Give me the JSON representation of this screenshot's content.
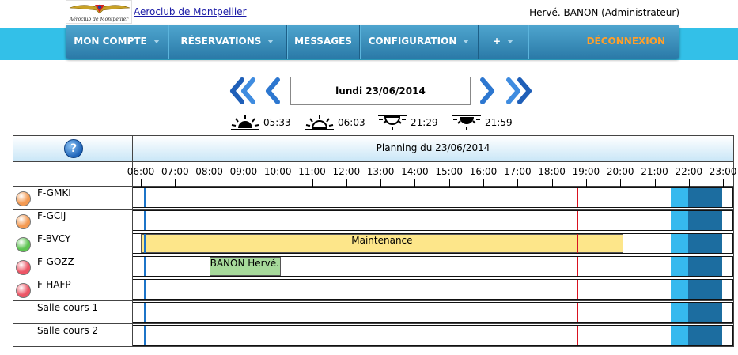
{
  "header": {
    "logo_text": "Aéroclub de Montpellier",
    "site_link": "Aeroclub de Montpellier",
    "user": "Hervé. BANON (Administrateur)"
  },
  "nav": {
    "items": [
      {
        "label": "MON COMPTE",
        "has_caret": true
      },
      {
        "label": "RÉSERVATIONS",
        "has_caret": true
      },
      {
        "label": "MESSAGES",
        "has_caret": false
      },
      {
        "label": "CONFIGURATION",
        "has_caret": true
      },
      {
        "label": "+",
        "has_caret": true
      }
    ],
    "logout": "DÉCONNEXION",
    "logout_color": "#ff9f2a"
  },
  "date_nav": {
    "current_date": "lundi 23/06/2014",
    "icons": [
      "double-left-arrow-icon",
      "left-arrow-icon",
      "right-arrow-icon",
      "double-right-arrow-icon"
    ]
  },
  "sun_times": [
    {
      "icon": "sunrise-dawn-icon",
      "time": "05:33"
    },
    {
      "icon": "sunrise-icon",
      "time": "06:03"
    },
    {
      "icon": "sunset-icon",
      "time": "21:29"
    },
    {
      "icon": "sunset-dusk-icon",
      "time": "21:59"
    }
  ],
  "planning": {
    "title": "Planning du 23/06/2014",
    "hours": [
      "06:00",
      "07:00",
      "08:00",
      "09:00",
      "10:00",
      "11:00",
      "12:00",
      "13:00",
      "14:00",
      "15:00",
      "16:00",
      "17:00",
      "18:00",
      "19:00",
      "20:00",
      "21:00",
      "22:00",
      "23:00"
    ],
    "resources": [
      {
        "name": "F-GMKI",
        "status": "orange",
        "reservations": []
      },
      {
        "name": "F-GCIJ",
        "status": "orange",
        "reservations": []
      },
      {
        "name": "F-BVCY",
        "status": "green",
        "reservations": [
          {
            "label": "Maintenance",
            "start": "06:00",
            "end": "20:05",
            "color": "#fde68a"
          }
        ]
      },
      {
        "name": "F-GOZZ",
        "status": "red",
        "reservations": [
          {
            "label": "BANON Hervé.",
            "start": "08:00",
            "end": "10:05",
            "color": "#a6d99a"
          }
        ]
      },
      {
        "name": "F-HAFP",
        "status": "red",
        "reservations": []
      },
      {
        "name": "Salle cours 1",
        "status": "none",
        "reservations": []
      },
      {
        "name": "Salle cours 2",
        "status": "none",
        "reservations": []
      }
    ],
    "now_time": "06:05",
    "red_marker_time": "18:45",
    "dusk_start": "21:29",
    "night_start": "21:59",
    "status_colors": {
      "orange": "#f49a52",
      "green": "#5ec452",
      "red": "#ec5565"
    }
  }
}
